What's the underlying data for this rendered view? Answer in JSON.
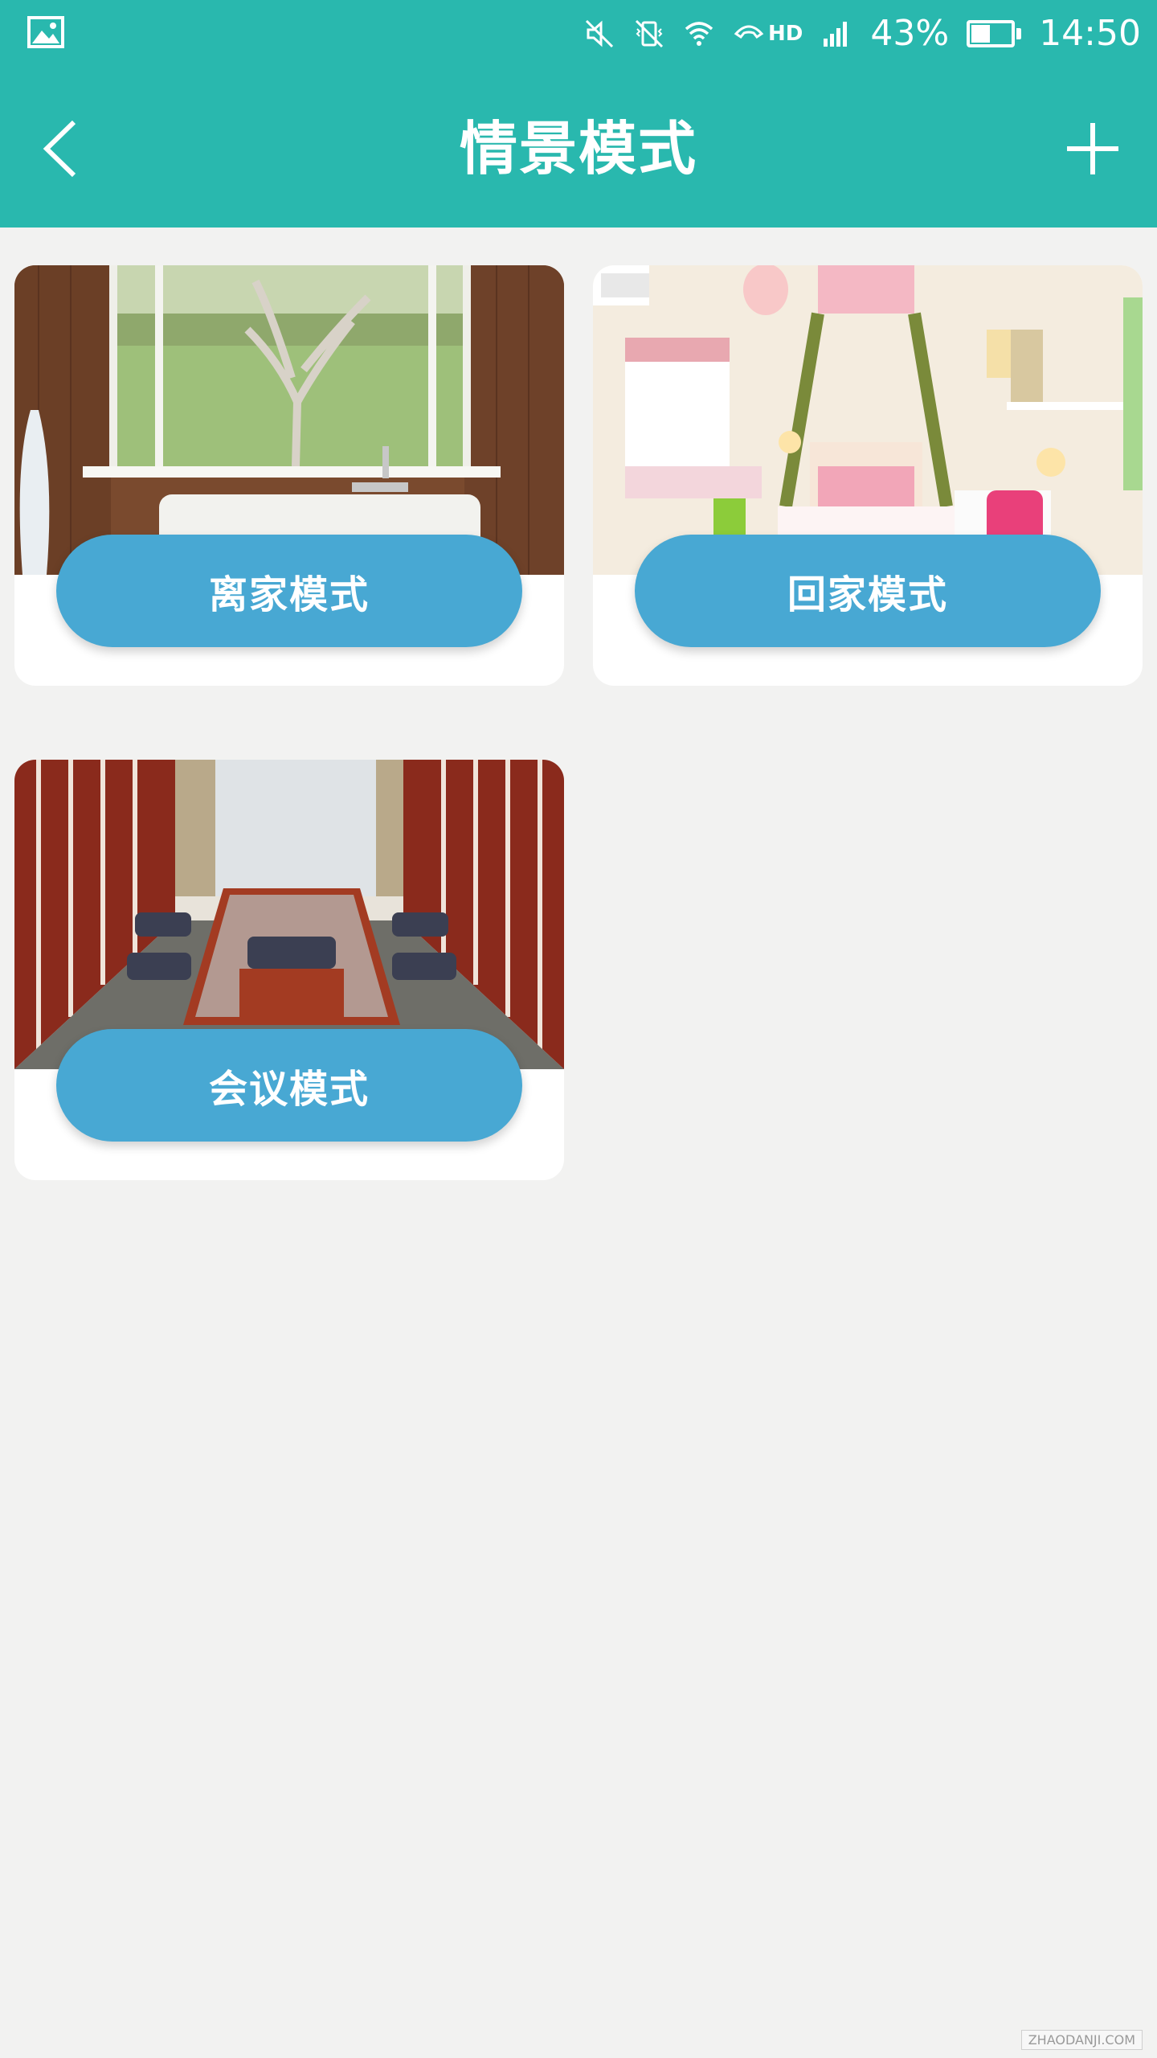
{
  "status_bar": {
    "battery": "43%",
    "battery_level": 0.43,
    "time": "14:50",
    "network_label": "HD",
    "icons": [
      "gallery-icon",
      "mute-icon",
      "vibrate-off-icon",
      "wifi-icon",
      "hd-call-icon",
      "signal-icon",
      "battery-icon"
    ]
  },
  "header": {
    "title": "情景模式",
    "back_icon": "chevron-left-icon",
    "add_icon": "plus-icon"
  },
  "modes": [
    {
      "label": "离家模式",
      "image": "sink-window-photo"
    },
    {
      "label": "回家模式",
      "image": "bedroom-photo"
    },
    {
      "label": "会议模式",
      "image": "meeting-room-photo"
    }
  ],
  "watermark": "ZHAODANJI.COM",
  "colors": {
    "primary": "#29b8ae",
    "button": "#48a8d3",
    "background": "#f2f2f1"
  }
}
